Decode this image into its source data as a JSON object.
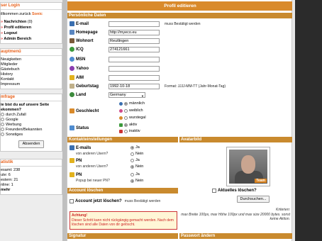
{
  "sidebar": {
    "login": {
      "title": "ser Login",
      "welcome_prefix": "illkommen zurück ",
      "welcome_user": "Sonic",
      "links": [
        {
          "label": "Nachrichten",
          "count": "(0)"
        },
        {
          "label": "Profil editieren",
          "count": ""
        },
        {
          "label": "Logout",
          "count": ""
        },
        {
          "label": "Admin Bereich",
          "count": ""
        }
      ]
    },
    "menu": {
      "title": "auptmenü",
      "items": [
        "Neuigkeiten",
        "Mitglieder",
        "Gästebuch",
        "History",
        "Kontakt",
        "Impressum"
      ]
    },
    "poll": {
      "title": "mfrage",
      "question": "ie bist du auf unsere Seite ekommen?",
      "options": [
        "durch Zufall",
        "Google",
        "Werbung",
        "Freunden/Bekannten",
        "Sonstiges"
      ],
      "button": "Absenden"
    },
    "stats": {
      "title": "atistik",
      "lines": [
        "esamt: 238",
        "ute: 6",
        "estern: 21",
        "nline: 1",
        "mehr"
      ]
    }
  },
  "main": {
    "title": "Profil editieren",
    "personal_header": "Persönliche Daten",
    "fields": [
      {
        "label": "E-mail",
        "value": "",
        "note": "muss Bestätigt werden",
        "icon": "email-icon",
        "color": "#3a6fb0"
      },
      {
        "label": "Homepage",
        "value": "http://myeco.eu",
        "note": "",
        "icon": "homepage-icon",
        "color": "#5a86c0"
      },
      {
        "label": "Wohnort",
        "value": "Reutlingen",
        "note": "",
        "icon": "house-icon",
        "color": "#7a5a3a"
      },
      {
        "label": "ICQ",
        "value": "274121661",
        "note": "",
        "icon": "icq-icon",
        "color": "#3c9a3c"
      },
      {
        "label": "MSN",
        "value": "",
        "note": "",
        "icon": "msn-icon",
        "color": "#4f8ccf"
      },
      {
        "label": "Yahoo",
        "value": "",
        "note": "",
        "icon": "yahoo-icon",
        "color": "#8a3cb0"
      },
      {
        "label": "AIM",
        "value": "",
        "note": "",
        "icon": "aim-icon",
        "color": "#e2b21e"
      },
      {
        "label": "Geburtstag",
        "value": "1992-10-18",
        "note": "Format: JJJJ-MM-TT (Jahr-Monat-Tag)",
        "icon": "calendar-icon",
        "color": "#c0b08a"
      }
    ],
    "land": {
      "label": "Land",
      "value": "Germany",
      "icon": "globe-icon"
    },
    "geschlecht": {
      "label": "Geschlecht",
      "options": [
        "männlich",
        "weiblich",
        "wurstegal"
      ],
      "selected": 0,
      "icon": "gender-icon"
    },
    "status": {
      "label": "Status",
      "options": [
        "aktiv",
        "inaktiv"
      ],
      "selected": 0,
      "icon": "status-icon"
    },
    "contact_header": "Kontakteinstellungen",
    "contact": [
      {
        "label": "E-mails",
        "sub": "von anderen Usern?",
        "ja": "Ja",
        "nein": "Nein",
        "selected": "ja"
      },
      {
        "label": "PN",
        "sub": "von anderen Usern?",
        "ja": "Ja",
        "nein": "Nein",
        "selected": "nein"
      },
      {
        "label": "PN",
        "sub": "Popup bei neuer PN?",
        "ja": "Ja",
        "nein": "Nein",
        "selected": "nein"
      }
    ],
    "delete_header": "Account löschen",
    "delete_label": "Account jetzt löschen?",
    "delete_note": "muss Bestätigt werden",
    "warning_title": "Achtung!",
    "warning_text": "Dieser Schritt kann nicht rückgängig gemacht werden. Nach dem löschen sind alle Daten von dir gelöscht.",
    "avatar_header": "Avatarbild",
    "avatar_badge": "Team",
    "avatar_delete_label": "Aktuelles löschen?",
    "browse_button": "Durchsuchen...",
    "avatar_criteria": "Kriterien:",
    "avatar_criteria_text": "max Breite 100px, max Höhe 100px und max size 20000 bytes. sonst keine Aktion.",
    "signature_header": "Signatur",
    "password_header": "Passwort ändern"
  }
}
